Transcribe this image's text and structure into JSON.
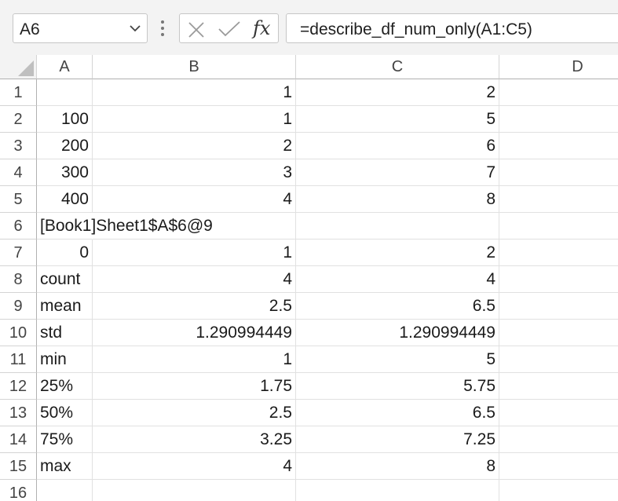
{
  "name_box": {
    "value": "A6",
    "chevron_icon": "chevron-down-icon"
  },
  "formula_bar": {
    "cancel_icon": "cancel-x-icon",
    "enter_icon": "checkmark-icon",
    "fx_label": "fx",
    "formula": "=describe_df_num_only(A1:C5)"
  },
  "columns": [
    "A",
    "B",
    "C",
    "D"
  ],
  "rows": [
    {
      "n": "1",
      "a": "",
      "b": "1",
      "c": "2",
      "d": ""
    },
    {
      "n": "2",
      "a": "100",
      "b": "1",
      "c": "5",
      "d": ""
    },
    {
      "n": "3",
      "a": "200",
      "b": "2",
      "c": "6",
      "d": ""
    },
    {
      "n": "4",
      "a": "300",
      "b": "3",
      "c": "7",
      "d": ""
    },
    {
      "n": "5",
      "a": "400",
      "b": "4",
      "c": "8",
      "d": ""
    },
    {
      "n": "6",
      "a": "[Book1]Sheet1$A$6@9",
      "b": "",
      "c": "",
      "d": ""
    },
    {
      "n": "7",
      "a": "0",
      "b": "1",
      "c": "2",
      "d": ""
    },
    {
      "n": "8",
      "a": "count",
      "b": "4",
      "c": "4",
      "d": ""
    },
    {
      "n": "9",
      "a": "mean",
      "b": "2.5",
      "c": "6.5",
      "d": ""
    },
    {
      "n": "10",
      "a": "std",
      "b": "1.290994449",
      "c": "1.290994449",
      "d": ""
    },
    {
      "n": "11",
      "a": "min",
      "b": "1",
      "c": "5",
      "d": ""
    },
    {
      "n": "12",
      "a": "25%",
      "b": "1.75",
      "c": "5.75",
      "d": ""
    },
    {
      "n": "13",
      "a": "50%",
      "b": "2.5",
      "c": "6.5",
      "d": ""
    },
    {
      "n": "14",
      "a": "75%",
      "b": "3.25",
      "c": "7.25",
      "d": ""
    },
    {
      "n": "15",
      "a": "max",
      "b": "4",
      "c": "8",
      "d": ""
    },
    {
      "n": "16",
      "a": "",
      "b": "",
      "c": "",
      "d": ""
    }
  ]
}
